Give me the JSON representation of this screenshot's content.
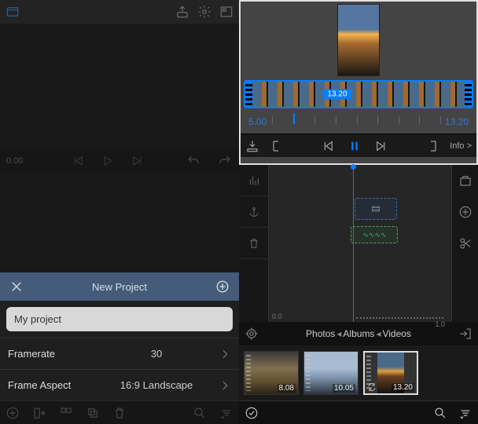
{
  "left": {
    "preview": {
      "time": "0.00"
    },
    "new_project": {
      "title": "New Project",
      "name_value": "My project",
      "rows": {
        "framerate": {
          "label": "Framerate",
          "value": "30"
        },
        "aspect": {
          "label": "Frame Aspect",
          "value": "16:9  Landscape"
        }
      }
    }
  },
  "right": {
    "filmstrip_label": "13.20",
    "scale": {
      "start": "5.00",
      "end": "13.20"
    },
    "info_label": "Info >",
    "zoom_tick": "0.0",
    "zoom_end": "1.0",
    "browser": {
      "crumb1": "Photos",
      "crumb2": "Albums",
      "crumb3": "Videos"
    },
    "thumbs": [
      {
        "duration": "8.08"
      },
      {
        "duration": "10.05"
      },
      {
        "duration": "13.20"
      }
    ]
  },
  "colors": {
    "accent": "#0a7cff",
    "header_bar": "#445c7a"
  }
}
